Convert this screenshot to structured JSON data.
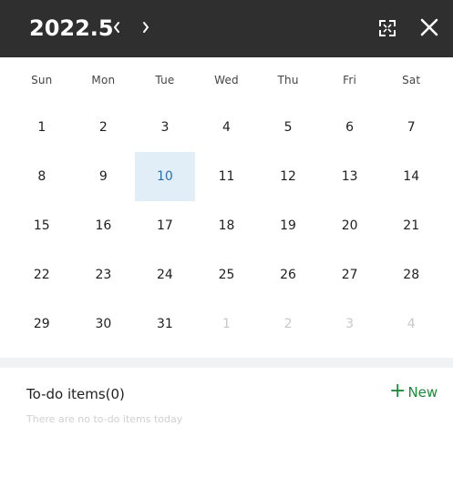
{
  "header": {
    "month_label": "2022.5"
  },
  "weekdays": [
    "Sun",
    "Mon",
    "Tue",
    "Wed",
    "Thu",
    "Fri",
    "Sat"
  ],
  "weeks": [
    [
      "1",
      "2",
      "3",
      "4",
      "5",
      "6",
      "7"
    ],
    [
      "8",
      "9",
      "10",
      "11",
      "12",
      "13",
      "14"
    ],
    [
      "15",
      "16",
      "17",
      "18",
      "19",
      "20",
      "21"
    ],
    [
      "22",
      "23",
      "24",
      "25",
      "26",
      "27",
      "28"
    ],
    [
      "29",
      "30",
      "31",
      "1",
      "2",
      "3",
      "4"
    ]
  ],
  "todo": {
    "title": "To-do items(0)",
    "new_label": "New",
    "empty_text": "There are no to-do items today"
  },
  "colors": {
    "header_bg": "#2f2f2f",
    "today_bg": "#e1eef8",
    "today_text": "#2b6fb3",
    "new_button": "#1f8a3a"
  }
}
